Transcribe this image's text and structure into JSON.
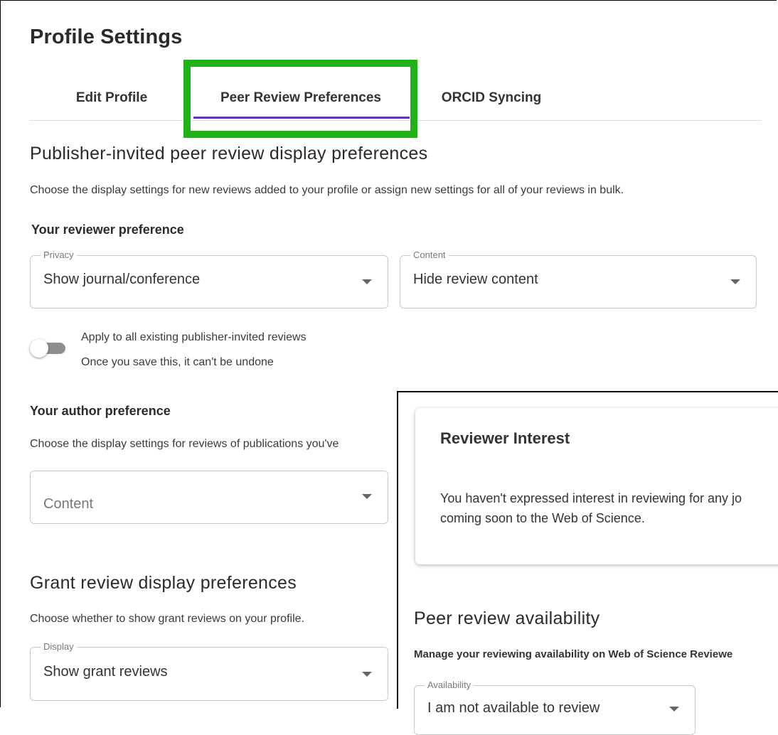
{
  "page": {
    "title": "Profile Settings"
  },
  "tabs": [
    {
      "label": "Edit Profile"
    },
    {
      "label": "Peer Review Preferences"
    },
    {
      "label": "ORCID Syncing"
    }
  ],
  "publisher_section": {
    "title": "Publisher-invited peer review display preferences",
    "description": "Choose the display settings for new reviews added to your profile or assign new settings for all of your reviews in bulk.",
    "reviewer_preference": {
      "heading": "Your reviewer preference",
      "privacy": {
        "legend": "Privacy",
        "value": "Show journal/conference"
      },
      "content": {
        "legend": "Content",
        "value": "Hide review content"
      }
    },
    "apply_toggle": {
      "label": "Apply to all existing publisher-invited reviews",
      "note": "Once you save this, it can't be undone",
      "on": false
    },
    "author_preference": {
      "heading": "Your author preference",
      "description": "Choose the display settings for reviews of publications you've",
      "content": {
        "placeholder": "Content"
      }
    }
  },
  "grant_section": {
    "title": "Grant review display preferences",
    "description": "Choose whether to show grant reviews on your profile.",
    "display": {
      "legend": "Display",
      "value": "Show grant reviews"
    }
  },
  "reviewer_interest": {
    "title": "Reviewer Interest",
    "line1": "You haven't expressed interest in reviewing for any jo",
    "line2": "coming soon to the Web of Science."
  },
  "availability_section": {
    "title": "Peer review availability",
    "description": "Manage your reviewing availability on Web of Science Reviewe",
    "availability": {
      "legend": "Availability",
      "value": "I am not available to review"
    }
  },
  "colors": {
    "accent": "#5e33bf",
    "highlight": "#1fb317"
  },
  "icons": {
    "dropdown": "caret-down-icon"
  }
}
